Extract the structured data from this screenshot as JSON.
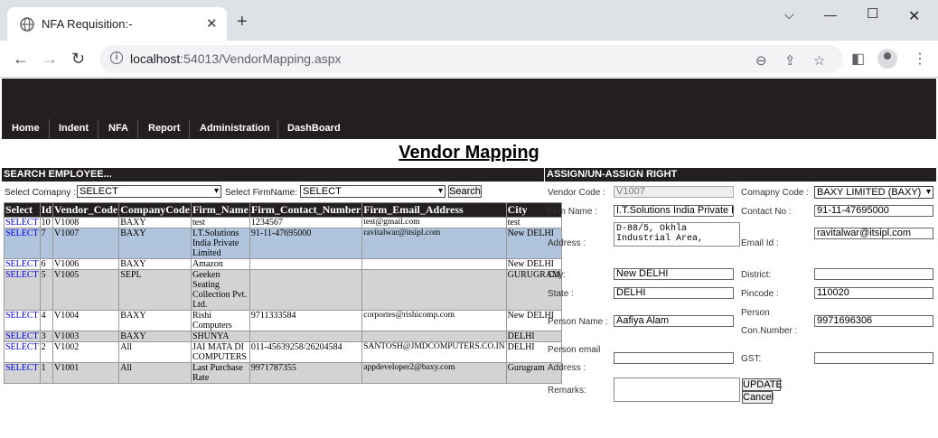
{
  "browser": {
    "tab_title": "NFA Requisition:-",
    "url_host": "localhost",
    "url_rest": ":54013/VendorMapping.aspx"
  },
  "menu": [
    "Home",
    "Indent",
    "NFA",
    "Report",
    "Administration",
    "DashBoard"
  ],
  "page_title": "Vendor Mapping",
  "search": {
    "section_title": "SEARCH EMPLOYEE...",
    "company_label": "Select Comapny :",
    "company_value": "SELECT",
    "firm_label": "Select FirmName:",
    "firm_value": "SELECT",
    "search_button": "Search"
  },
  "grid": {
    "columns": [
      "Select",
      "Id",
      "Vendor_Code",
      "CompanyCode",
      "Firm_Name",
      "Firm_Contact_Number",
      "Firm_Email_Address",
      "City"
    ],
    "rows": [
      {
        "select": "SELECT",
        "id": "10",
        "vendor_code": "V1008",
        "company": "BAXY",
        "firm": "test",
        "contact": "1234567",
        "email": "test@gmail.com",
        "city": "test",
        "style": "white"
      },
      {
        "select": "SELECT",
        "id": "7",
        "vendor_code": "V1007",
        "company": "BAXY",
        "firm": "I.T.Solutions India Private Limited",
        "contact": "91-11-47695000",
        "email": "ravitalwar@itsipl.com",
        "city": "New DELHI",
        "style": "blue"
      },
      {
        "select": "SELECT",
        "id": "6",
        "vendor_code": "V1006",
        "company": "BAXY",
        "firm": "Amazon",
        "contact": "",
        "email": "",
        "city": "New DELHI",
        "style": "white"
      },
      {
        "select": "SELECT",
        "id": "5",
        "vendor_code": "V1005",
        "company": "SEPL",
        "firm": "Geeken Seating Collection Pvt. Ltd.",
        "contact": "",
        "email": "",
        "city": "GURUGRAM",
        "style": "gray"
      },
      {
        "select": "SELECT",
        "id": "4",
        "vendor_code": "V1004",
        "company": "BAXY",
        "firm": "Rishi Computers",
        "contact": "9711333584",
        "email": "corportes@rishicomp.com",
        "city": "New DELHI",
        "style": "white"
      },
      {
        "select": "SELECT",
        "id": "3",
        "vendor_code": "V1003",
        "company": "BAXY",
        "firm": "SHUNYA",
        "contact": "",
        "email": "",
        "city": "DELHI",
        "style": "gray"
      },
      {
        "select": "SELECT",
        "id": "2",
        "vendor_code": "V1002",
        "company": "All",
        "firm": "JAI MATA DI COMPUTERS",
        "contact": "011-45639258/26204584",
        "email": "SANTOSH@JMDCOMPUTERS.CO.IN",
        "city": "DELHI",
        "style": "white"
      },
      {
        "select": "SELECT",
        "id": "1",
        "vendor_code": "V1001",
        "company": "All",
        "firm": "Last Purchase Rate",
        "contact": "9971787355",
        "email": "appdeveloper2@baxy.com",
        "city": "Gurugram",
        "style": "gray"
      }
    ]
  },
  "assign": {
    "section_title": "ASSIGN/UN-ASSIGN RIGHT",
    "vendor_code_label": "Vendor Code :",
    "vendor_code_value": "V1007",
    "company_code_label": "Comapny Code :",
    "company_code_value": "BAXY LIMITED (BAXY)",
    "firm_name_label": "Firm Name :",
    "firm_name_value": "I.T.Solutions India Private Limited",
    "contact_label": "Contact No :",
    "contact_value": "91-11-47695000",
    "address_label": "Address :",
    "address_value": "D-88/5, Okhla Industrial Area,",
    "email_label": "Email Id :",
    "email_value": "ravitalwar@itsipl.com",
    "city_label": "City:",
    "city_value": "New DELHI",
    "district_label": "District:",
    "district_value": "",
    "state_label": "State :",
    "state_value": "DELHI",
    "pincode_label": "Pincode :",
    "pincode_value": "110020",
    "person_name_label": "Person Name :",
    "person_name_value": "Aafiya Alam",
    "person_con_label_1": "Person",
    "person_con_label_2": "Con.Number :",
    "person_con_value": "9971696306",
    "person_email_label_1": "Person email",
    "person_email_label_2": "Address :",
    "person_email_value": "",
    "gst_label": "GST:",
    "gst_value": "",
    "remarks_label": "Remarks:",
    "remarks_value": "",
    "update_button": "UPDATE",
    "cancel_button": "Cancel"
  }
}
